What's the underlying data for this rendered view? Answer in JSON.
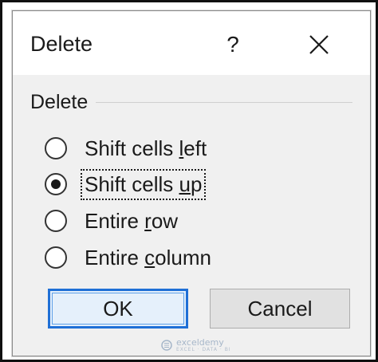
{
  "dialog": {
    "title": "Delete",
    "help_label": "?",
    "close_icon": "close-icon"
  },
  "group": {
    "label": "Delete",
    "options": [
      {
        "pre": "Shift cells ",
        "accel": "l",
        "post": "eft",
        "selected": false
      },
      {
        "pre": "Shift cells ",
        "accel": "u",
        "post": "p",
        "selected": true
      },
      {
        "pre": "Entire ",
        "accel": "r",
        "post": "ow",
        "selected": false
      },
      {
        "pre": "Entire ",
        "accel": "c",
        "post": "olumn",
        "selected": false
      }
    ]
  },
  "buttons": {
    "ok_label": "OK",
    "cancel_label": "Cancel"
  },
  "watermark": {
    "brand": "exceldemy",
    "tagline": "EXCEL · DATA · BI"
  },
  "colors": {
    "accent": "#1f6fd6",
    "dialog_bg": "#f0f0f0"
  }
}
